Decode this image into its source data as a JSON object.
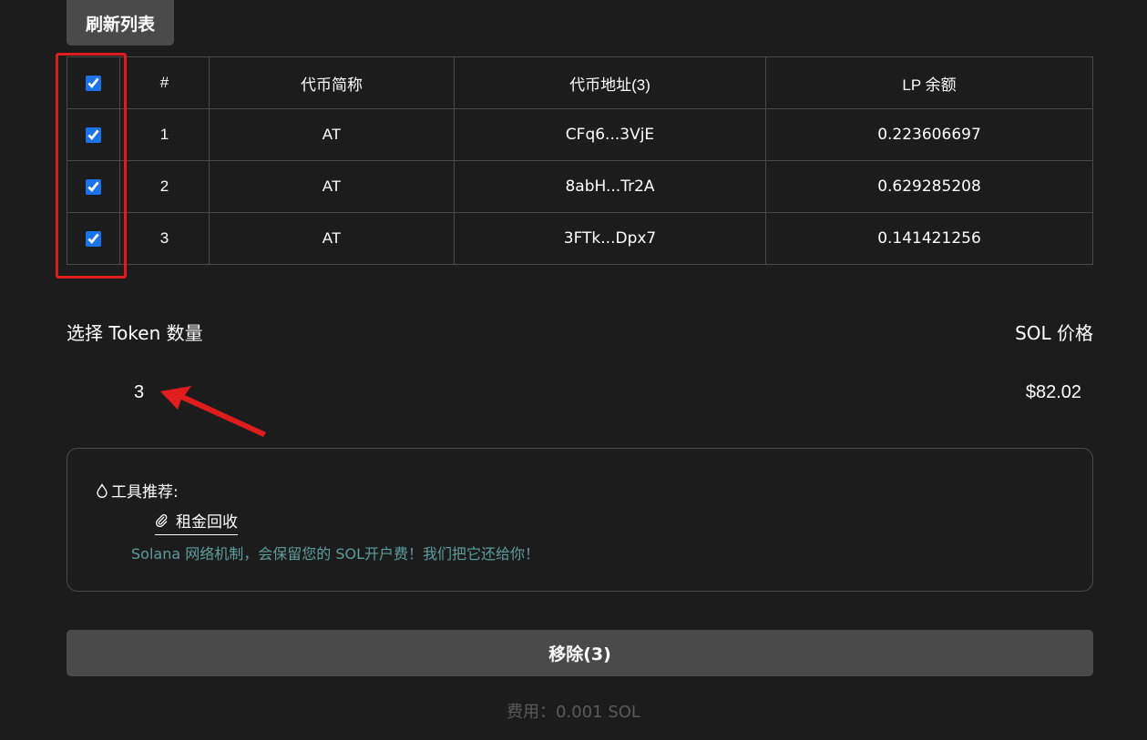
{
  "toolbar": {
    "refresh_label": "刷新列表"
  },
  "table": {
    "headers": {
      "index": "#",
      "name": "代币简称",
      "address": "代币地址(3)",
      "balance": "LP 余额"
    },
    "rows": [
      {
        "index": "1",
        "name": "AT",
        "address": "CFq6...3VjE",
        "balance": "0.223606697",
        "checked": true
      },
      {
        "index": "2",
        "name": "AT",
        "address": "8abH...Tr2A",
        "balance": "0.629285208",
        "checked": true
      },
      {
        "index": "3",
        "name": "AT",
        "address": "3FTk...Dpx7",
        "balance": "0.141421256",
        "checked": true
      }
    ],
    "all_checked": true
  },
  "summary": {
    "count_label": "选择 Token 数量",
    "count_value": "3",
    "price_label": "SOL 价格",
    "price_value": "$82.02"
  },
  "tools": {
    "title": "工具推荐:",
    "link_label": "租金回收",
    "description": "Solana 网络机制，会保留您的 SOL开户费！我们把它还给你！"
  },
  "action": {
    "remove_label": "移除(3)",
    "fee_text": "费用：0.001 SOL"
  },
  "colors": {
    "background": "#1c1c1c",
    "button": "#4a4a4a",
    "annotation": "#e01d1d",
    "description": "#5e9d9d",
    "checkbox": "#1a73e8"
  },
  "icons": {
    "tools_title": "drop-icon",
    "tool_link": "paperclip-icon"
  }
}
